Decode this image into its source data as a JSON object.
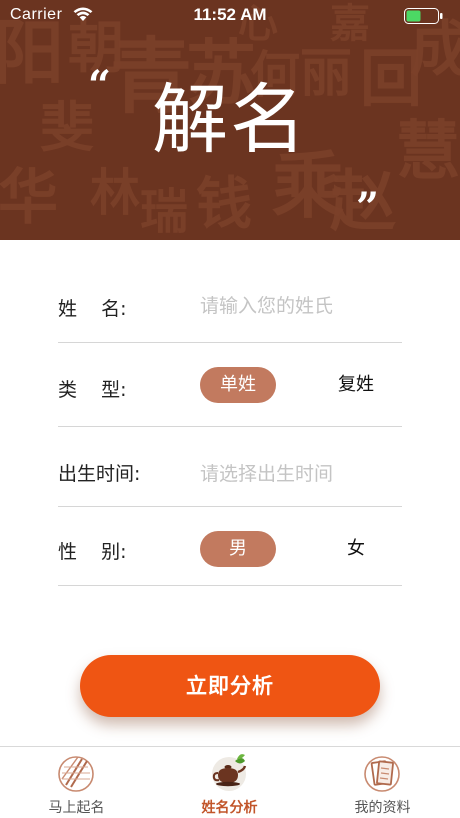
{
  "status_bar": {
    "carrier": "Carrier",
    "time": "11:52 AM"
  },
  "banner": {
    "title": "解名",
    "quote_open": "“",
    "quote_close": "”"
  },
  "form": {
    "surname": {
      "label": "姓    名:",
      "placeholder": "请输入您的姓氏",
      "value": ""
    },
    "type": {
      "label": "类    型:",
      "options": [
        "单姓",
        "复姓"
      ],
      "selected": "单姓"
    },
    "birth": {
      "label": "出生时间:",
      "placeholder": "请选择出生时间"
    },
    "gender": {
      "label": "性    别:",
      "options": [
        "男",
        "女"
      ],
      "selected": "男"
    }
  },
  "actions": {
    "analyze_label": "立即分析"
  },
  "tab_bar": {
    "tabs": [
      {
        "label": "马上起名",
        "icon": "bamboo-scroll-icon",
        "active": false
      },
      {
        "label": "姓名分析",
        "icon": "teapot-icon",
        "active": true
      },
      {
        "label": "我的资料",
        "icon": "book-icon",
        "active": false
      }
    ]
  },
  "colors": {
    "banner_bg": "#6b3420",
    "accent": "#ef5513",
    "selected_option": "#c27a5f",
    "active_tab_label": "#c2552a",
    "placeholder": "#c4c4c4"
  }
}
